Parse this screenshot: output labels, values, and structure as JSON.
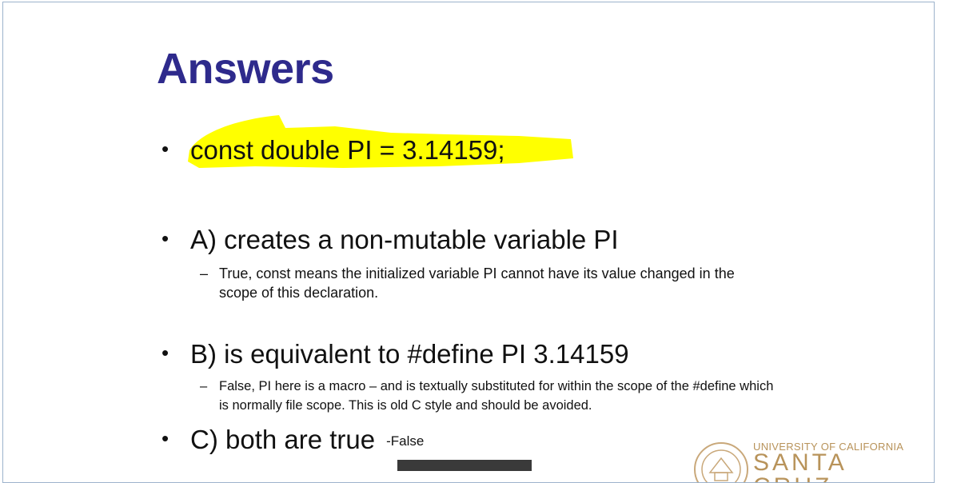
{
  "slide": {
    "title": "Answers",
    "highlight_color": "#ffff00",
    "title_color": "#2e2a8c",
    "bullets": [
      {
        "text": "const double PI = 3.14159;",
        "highlighted": true
      },
      {
        "text": "A) creates a non-mutable variable PI",
        "sub": "True, const means the initialized variable PI cannot have its value changed in the scope of this declaration."
      },
      {
        "text": "B) is equivalent to #define PI 3.14159",
        "sub": "False, PI here is a macro – and is textually substituted for within the scope of the #define which is normally file scope. This is old C style and should be avoided."
      },
      {
        "text": "C) both are true",
        "note": "-False"
      }
    ],
    "bullet_symbol": "•",
    "sub_symbol": "–"
  },
  "footer": {
    "university": "UNIVERSITY OF CALIFORNIA",
    "campus": "SANTA CRUZ",
    "logo_color": "#b8935a"
  }
}
